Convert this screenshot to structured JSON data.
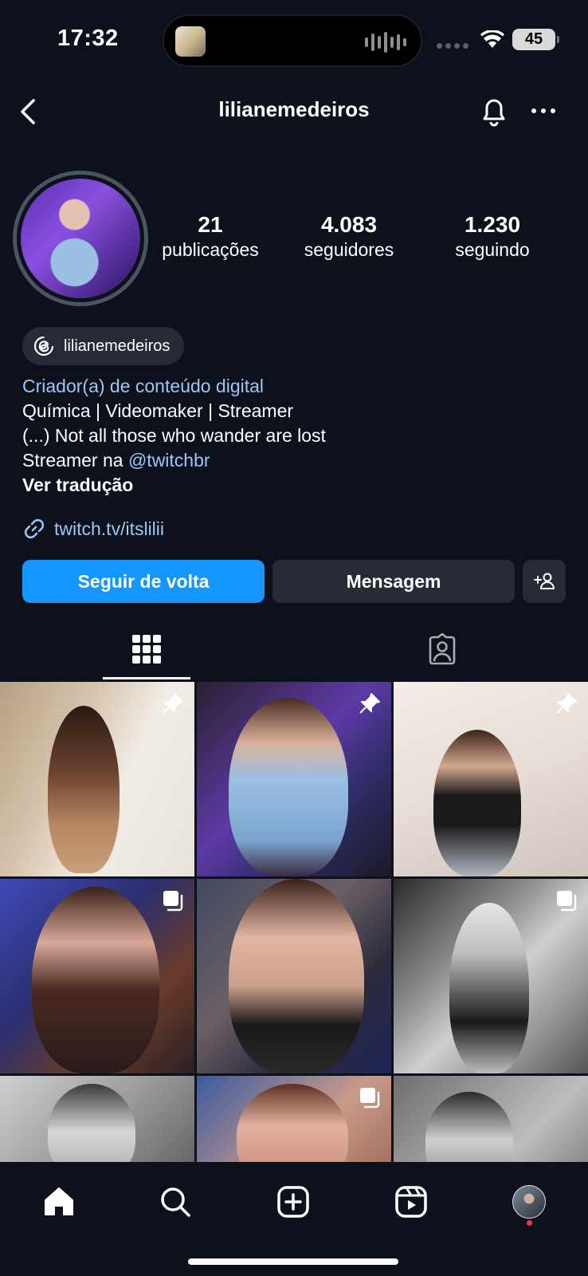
{
  "status_bar": {
    "time": "17:32",
    "battery": "45"
  },
  "header": {
    "username": "lilianemedeiros"
  },
  "stats": [
    {
      "value": "21",
      "label": "publicações"
    },
    {
      "value": "4.083",
      "label": "seguidores"
    },
    {
      "value": "1.230",
      "label": "seguindo"
    }
  ],
  "threads_chip": {
    "label": "lilianemedeiros"
  },
  "bio": {
    "category": "Criador(a) de conteúdo digital",
    "line1": "Química | Videomaker | Streamer",
    "line2": "(...) Not all those who wander are lost",
    "line3_prefix": "Streamer na ",
    "line3_mention": "@twitchbr",
    "translate": "Ver tradução"
  },
  "link": {
    "text": "twitch.tv/itslilii"
  },
  "buttons": {
    "follow_back": "Seguir de volta",
    "message": "Mensagem"
  },
  "posts": [
    {
      "badge": "pin-icon"
    },
    {
      "badge": "pin-icon"
    },
    {
      "badge": "pin-icon"
    },
    {
      "badge": "carousel-icon"
    },
    {
      "badge": "none"
    },
    {
      "badge": "carousel-icon"
    },
    {
      "badge": "none"
    },
    {
      "badge": "carousel-icon"
    },
    {
      "badge": "none"
    }
  ],
  "colors": {
    "accent": "#1596ff",
    "link": "#9ec6f5",
    "background": "#0c111b",
    "notification_dot": "#ff3040"
  }
}
